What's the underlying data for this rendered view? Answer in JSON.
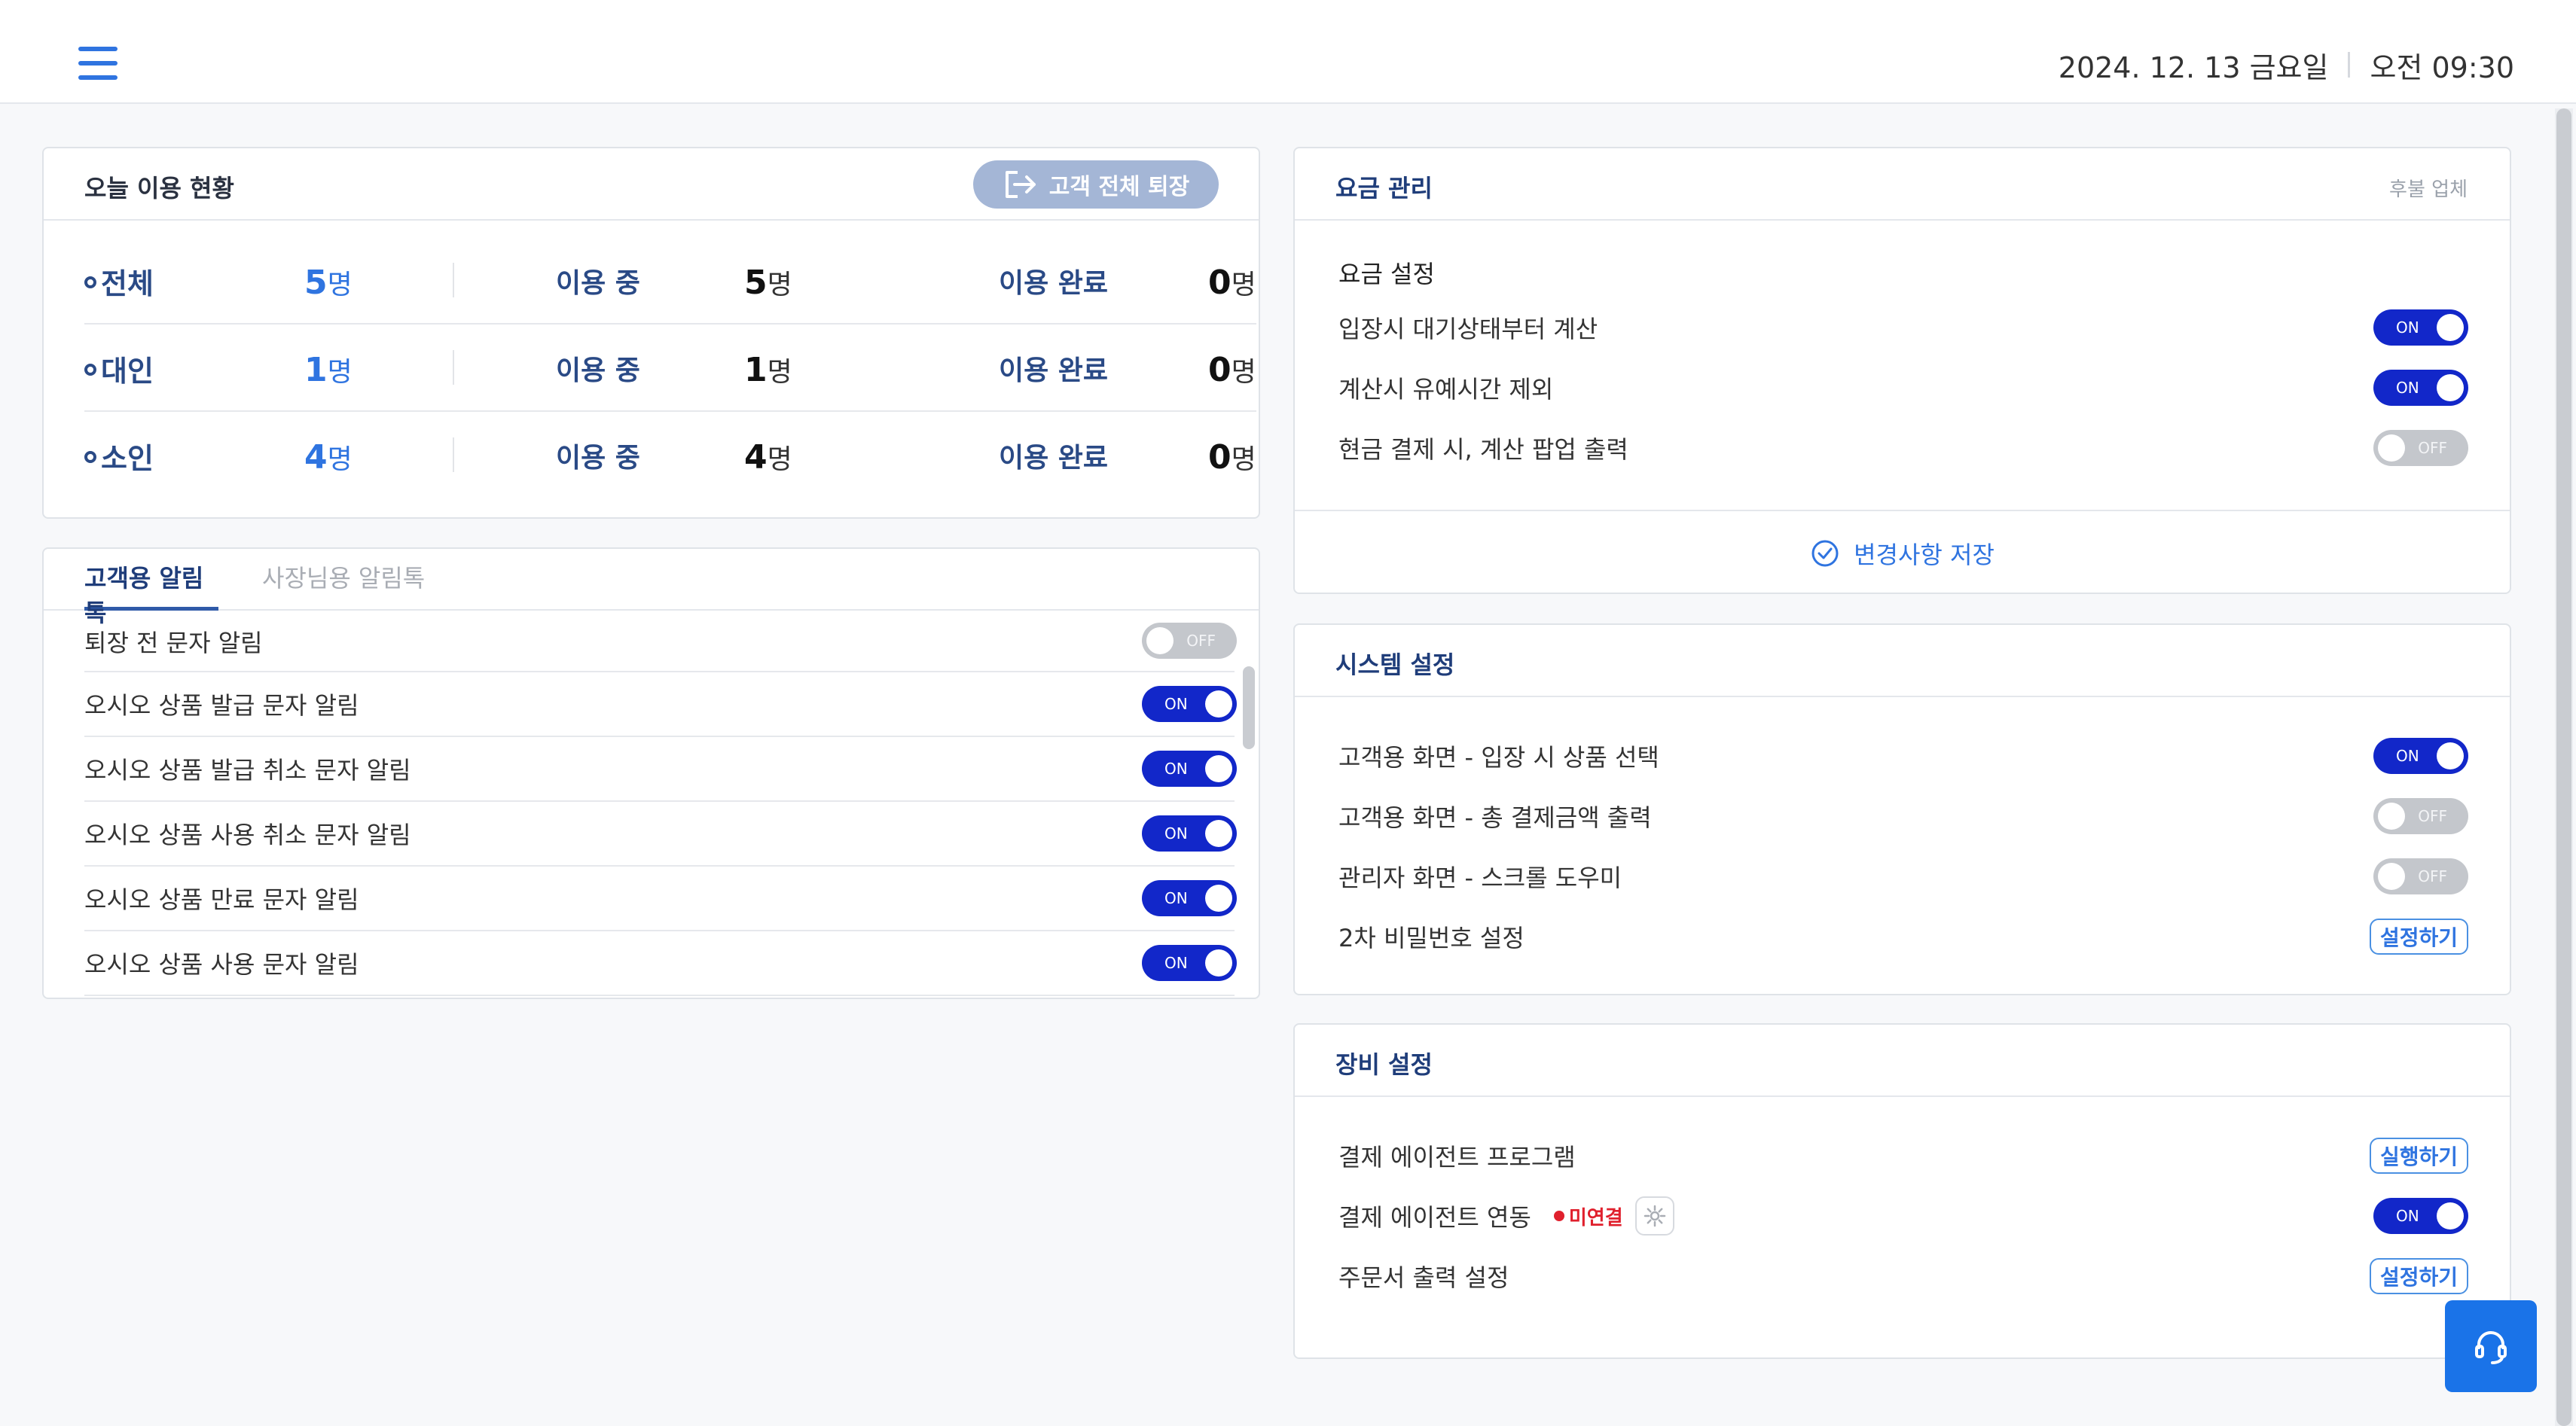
{
  "header": {
    "date": "2024. 12. 13 금요일",
    "time": "오전 09:30",
    "menu_icon": "hamburger-icon"
  },
  "usage": {
    "title": "오늘 이용 현황",
    "exit_button": "고객 전체 퇴장",
    "exit_icon": "logout-icon",
    "rows": [
      {
        "label": "전체",
        "total": "5",
        "total_unit": "명",
        "in_use_label": "이용 중",
        "in_use": "5",
        "in_use_unit": "명",
        "done_label": "이용 완료",
        "done": "0",
        "done_unit": "명"
      },
      {
        "label": "대인",
        "total": "1",
        "total_unit": "명",
        "in_use_label": "이용 중",
        "in_use": "1",
        "in_use_unit": "명",
        "done_label": "이용 완료",
        "done": "0",
        "done_unit": "명"
      },
      {
        "label": "소인",
        "total": "4",
        "total_unit": "명",
        "in_use_label": "이용 중",
        "in_use": "4",
        "in_use_unit": "명",
        "done_label": "이용 완료",
        "done": "0",
        "done_unit": "명"
      }
    ]
  },
  "notify": {
    "tabs": [
      "고객용 알림톡",
      "사장님용 알림톡"
    ],
    "active_tab": 0,
    "items": [
      {
        "label": "퇴장 전 문자 알림",
        "state": "OFF"
      },
      {
        "label": "오시오 상품 발급 문자 알림",
        "state": "ON"
      },
      {
        "label": "오시오 상품 발급 취소 문자 알림",
        "state": "ON"
      },
      {
        "label": "오시오 상품 사용 취소 문자 알림",
        "state": "ON"
      },
      {
        "label": "오시오 상품 만료 문자 알림",
        "state": "ON"
      },
      {
        "label": "오시오 상품 사용 문자 알림",
        "state": "ON"
      }
    ]
  },
  "fee": {
    "title": "요금 관리",
    "note": "후불 업체",
    "subtitle": "요금 설정",
    "items": [
      {
        "label": "입장시 대기상태부터 계산",
        "state": "ON"
      },
      {
        "label": "계산시 유예시간 제외",
        "state": "ON"
      },
      {
        "label": "현금 결제 시, 계산 팝업 출력",
        "state": "OFF"
      }
    ],
    "save_label": "변경사항 저장",
    "save_icon": "check-circle-icon"
  },
  "system": {
    "title": "시스템 설정",
    "items": [
      {
        "label": "고객용 화면 - 입장 시 상품 선택",
        "state": "ON"
      },
      {
        "label": "고객용 화면 - 총 결제금액 출력",
        "state": "OFF"
      },
      {
        "label": "관리자 화면 - 스크롤 도우미",
        "state": "OFF"
      },
      {
        "label": "2차 비밀번호 설정",
        "button": "설정하기"
      }
    ]
  },
  "device": {
    "title": "장비 설정",
    "items": [
      {
        "label": "결제 에이전트 프로그램",
        "button": "실행하기"
      },
      {
        "label": "결제 에이전트 연동",
        "badge": "미연결",
        "gear_icon": "gear-icon",
        "state": "ON"
      },
      {
        "label": "주문서 출력 설정",
        "button": "설정하기"
      }
    ]
  },
  "support": {
    "icon": "headset-icon"
  },
  "colors": {
    "accent": "#2f74e0",
    "toggle_on": "#1227c9",
    "toggle_off": "#c4c7cc",
    "title_navy": "#1f3d7a",
    "alert_red": "#e0202d"
  }
}
